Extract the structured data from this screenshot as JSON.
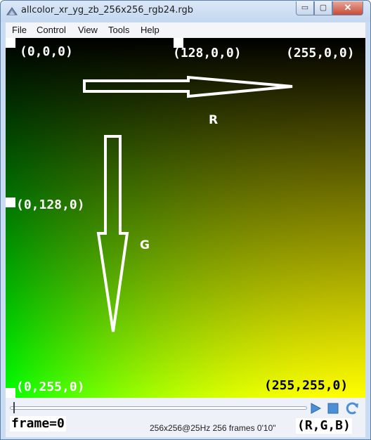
{
  "window": {
    "title": "allcolor_xr_yg_zb_256x256_rgb24.rgb",
    "minimize_glyph": "▭",
    "maximize_glyph": "▢",
    "close_glyph": "✕"
  },
  "menu": {
    "items": [
      "File",
      "Control",
      "View",
      "Tools",
      "Help"
    ]
  },
  "canvas": {
    "corner_labels": {
      "top_left": "(0,0,0)",
      "top_mid": "(128,0,0)",
      "top_right": "(255,0,0)",
      "mid_left": "(0,128,0)",
      "bottom_left": "(0,255,0)",
      "bottom_right": "(255,255,0)"
    },
    "axis_labels": {
      "r": "R",
      "g": "G"
    },
    "colors": {
      "black": "#000000",
      "red": "#ff0000",
      "green": "#00ff00",
      "yellow": "#ffff00"
    }
  },
  "player": {
    "status": "256x256@25Hz  256 frames   0'10\"",
    "frame_label": "frame=0",
    "legend_label": "(R,G,B)",
    "icons": [
      "play-icon",
      "stop-icon",
      "loop-icon"
    ],
    "progress_fraction": 0
  }
}
